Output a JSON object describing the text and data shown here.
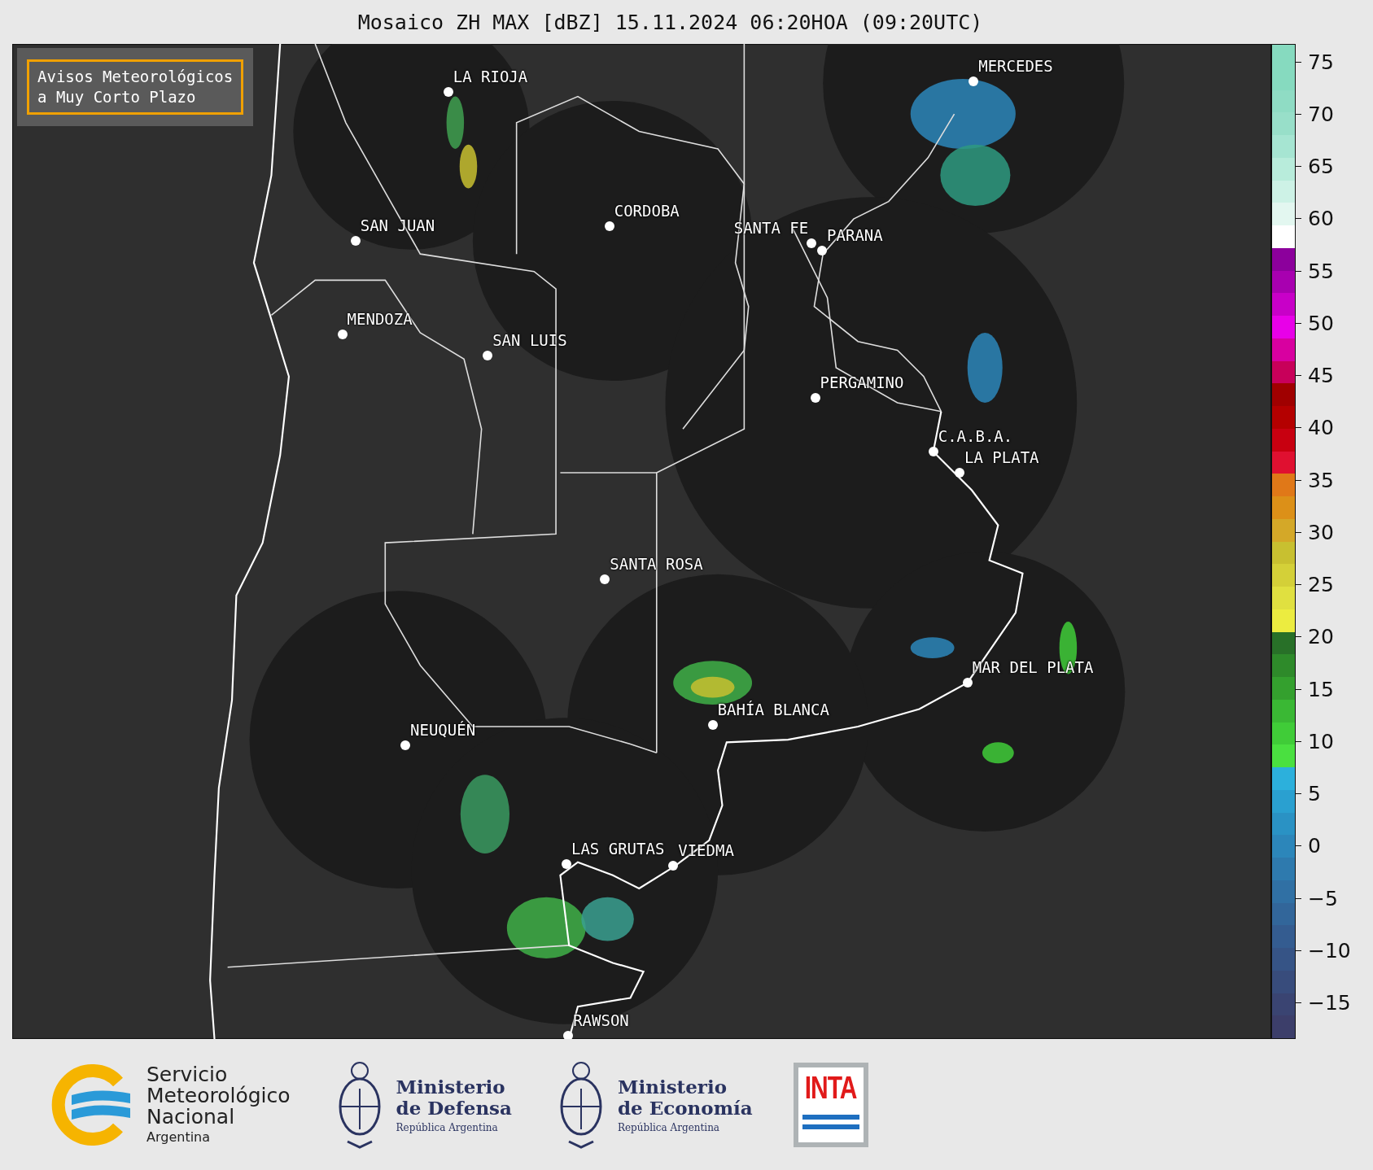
{
  "title": "Mosaico ZH MAX [dBZ] 15.11.2024 06:20HOA (09:20UTC)",
  "notice": "Avisos Meteorológicos\na Muy Corto Plazo",
  "cities": [
    {
      "name": "LA RIOJA"
    },
    {
      "name": "CORDOBA"
    },
    {
      "name": "SAN JUAN"
    },
    {
      "name": "SANTA FE"
    },
    {
      "name": "PARANA"
    },
    {
      "name": "MENDOZA"
    },
    {
      "name": "SAN LUIS"
    },
    {
      "name": "PERGAMINO"
    },
    {
      "name": "C.A.B.A."
    },
    {
      "name": "LA PLATA"
    },
    {
      "name": "SANTA ROSA"
    },
    {
      "name": "MAR DEL PLATA"
    },
    {
      "name": "BAHÍA BLANCA"
    },
    {
      "name": "NEUQUÉN"
    },
    {
      "name": "VIEDMA"
    },
    {
      "name": "LAS GRUTAS"
    },
    {
      "name": "RAWSON"
    },
    {
      "name": "MERCEDES"
    }
  ],
  "colorbar": {
    "ticks": [
      "75",
      "70",
      "65",
      "60",
      "55",
      "50",
      "45",
      "40",
      "35",
      "30",
      "25",
      "20",
      "15",
      "10",
      "5",
      "0",
      "−5",
      "−10",
      "−15"
    ],
    "bins": [
      {
        "color": "#86dabf"
      },
      {
        "color": "#86dabf"
      },
      {
        "color": "#8fdcc4"
      },
      {
        "color": "#98dfc9"
      },
      {
        "color": "#a6e5d2"
      },
      {
        "color": "#b8ecdb"
      },
      {
        "color": "#cdf2e6"
      },
      {
        "color": "#e3f7f0"
      },
      {
        "color": "#ffffff"
      },
      {
        "color": "#8c009c"
      },
      {
        "color": "#a800b0"
      },
      {
        "color": "#c800c8"
      },
      {
        "color": "#e800e8"
      },
      {
        "color": "#d800a0"
      },
      {
        "color": "#c8005a"
      },
      {
        "color": "#a00000"
      },
      {
        "color": "#b40000"
      },
      {
        "color": "#c80010"
      },
      {
        "color": "#e01030"
      },
      {
        "color": "#e07818"
      },
      {
        "color": "#dc9018"
      },
      {
        "color": "#d4a828"
      },
      {
        "color": "#c8c030"
      },
      {
        "color": "#d4d038"
      },
      {
        "color": "#e0e040"
      },
      {
        "color": "#ecec40"
      },
      {
        "color": "#287028"
      },
      {
        "color": "#2e8a2a"
      },
      {
        "color": "#34a02e"
      },
      {
        "color": "#3ab834"
      },
      {
        "color": "#40cc38"
      },
      {
        "color": "#4ae040"
      },
      {
        "color": "#2cb0dc"
      },
      {
        "color": "#2aa0d0"
      },
      {
        "color": "#2a92c4"
      },
      {
        "color": "#2c86ba"
      },
      {
        "color": "#2e7aae"
      },
      {
        "color": "#3070a4"
      },
      {
        "color": "#32669a"
      },
      {
        "color": "#345c90"
      },
      {
        "color": "#365486"
      },
      {
        "color": "#384c7c"
      },
      {
        "color": "#3a4472"
      },
      {
        "color": "#3c3e6a"
      }
    ]
  },
  "logos": {
    "smn": {
      "name": "Servicio\nMeteorológico\nNacional",
      "country": "Argentina"
    },
    "ministries": [
      {
        "name": "Ministerio\nde Defensa",
        "country": "República Argentina"
      },
      {
        "name": "Ministerio\nde Economía",
        "country": "República Argentina"
      }
    ],
    "inta": "INTA"
  }
}
